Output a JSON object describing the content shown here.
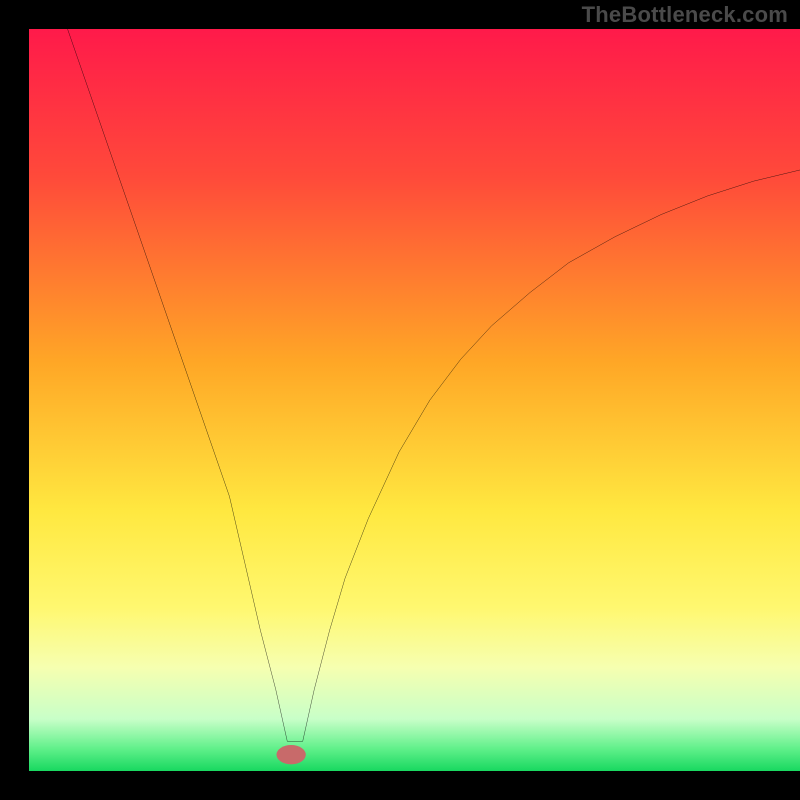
{
  "watermark": "TheBottleneck.com",
  "chart_data": {
    "type": "line",
    "title": "",
    "xlabel": "",
    "ylabel": "",
    "xlim": [
      0,
      100
    ],
    "ylim": [
      0,
      100
    ],
    "gradient_stops": [
      {
        "pct": 0,
        "color": "#ff1a4a"
      },
      {
        "pct": 20,
        "color": "#ff4a3a"
      },
      {
        "pct": 45,
        "color": "#ffa726"
      },
      {
        "pct": 65,
        "color": "#ffe840"
      },
      {
        "pct": 78,
        "color": "#fff870"
      },
      {
        "pct": 86,
        "color": "#f6ffb0"
      },
      {
        "pct": 93,
        "color": "#c8ffc8"
      },
      {
        "pct": 97,
        "color": "#60f08a"
      },
      {
        "pct": 100,
        "color": "#18d860"
      }
    ],
    "curve": {
      "x": [
        5,
        8,
        11,
        14,
        17,
        20,
        23,
        26,
        28,
        30,
        32,
        33.5,
        35.5,
        37,
        39,
        41,
        44,
        48,
        52,
        56,
        60,
        65,
        70,
        76,
        82,
        88,
        94,
        100
      ],
      "y": [
        100,
        91,
        82,
        73,
        64,
        55,
        46,
        37,
        28,
        19,
        11,
        4,
        4,
        11,
        19,
        26,
        34,
        43,
        50,
        55.5,
        60,
        64.5,
        68.5,
        72,
        75,
        77.5,
        79.5,
        81
      ]
    },
    "marker": {
      "x": 34.0,
      "y": 2.2,
      "rx": 1.9,
      "ry": 1.3,
      "color": "#c86a6a"
    }
  }
}
